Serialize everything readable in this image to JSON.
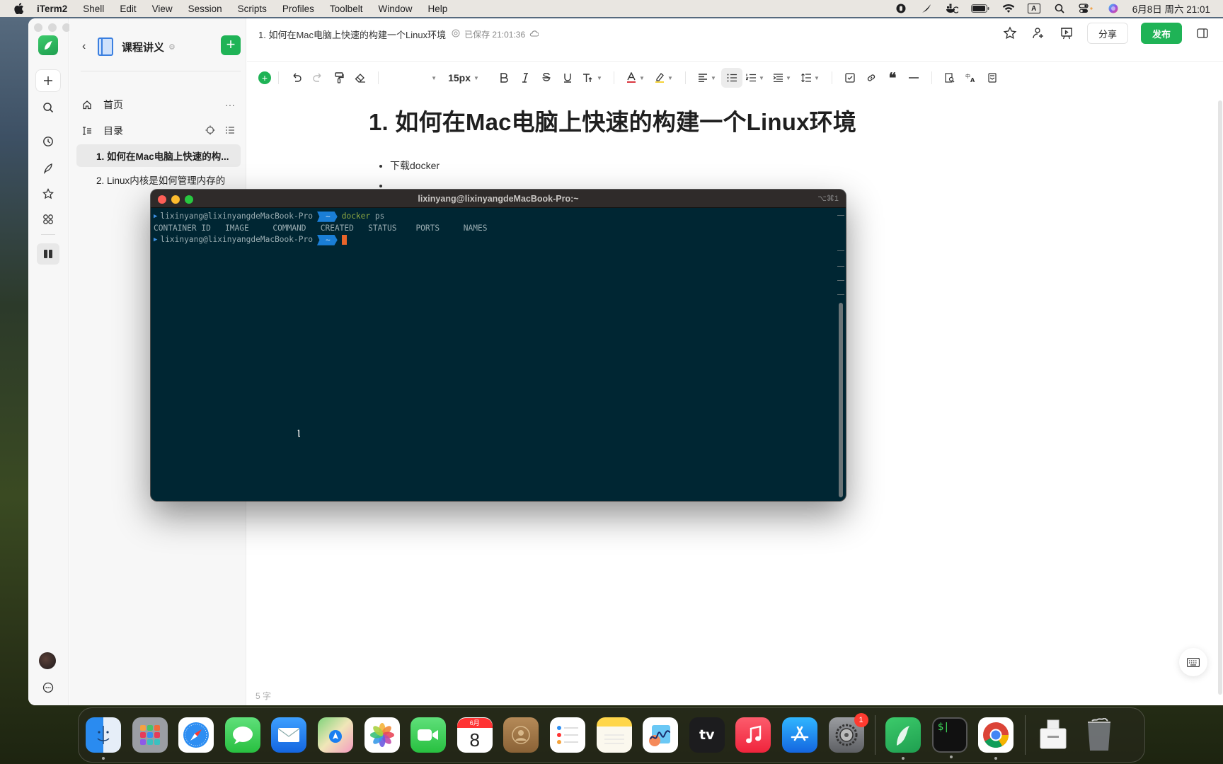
{
  "menubar": {
    "app": "iTerm2",
    "items": [
      "Shell",
      "Edit",
      "View",
      "Session",
      "Scripts",
      "Profiles",
      "Toolbelt",
      "Window",
      "Help"
    ],
    "status_icons": [
      "record-icon",
      "feather-icon",
      "docker-icon",
      "battery-icon",
      "wifi-icon",
      "input-source-icon",
      "spotlight-icon",
      "control-center-icon",
      "siri-icon"
    ],
    "input_source": "A",
    "clock": "6月8日 周六  21:01"
  },
  "sidebar": {
    "book_title": "课程讲义",
    "nav": [
      {
        "label": "首页",
        "icon": "home-icon"
      },
      {
        "label": "目录",
        "icon": "toc-icon"
      }
    ],
    "toc": [
      {
        "label": "1. 如何在Mac电脑上快速的构...",
        "active": true
      },
      {
        "label": "2. Linux内核是如何管理内存的",
        "active": false
      }
    ]
  },
  "editor": {
    "doc_title": "1. 如何在Mac电脑上快速的构建一个Linux环境",
    "saved_status": "已保存 21:01:36",
    "share_label": "分享",
    "publish_label": "发布",
    "font_size": "15px",
    "heading": "1. 如何在Mac电脑上快速的构建一个Linux环境",
    "bullets": [
      "下载docker",
      ""
    ],
    "word_count": "5 字"
  },
  "terminal": {
    "title": "lixinyang@lixinyangdeMacBook-Pro:~",
    "shortcut": "⌥⌘1",
    "prompt_user": "lixinyang@lixinyangdeMacBook-Pro",
    "prompt_dir": "~",
    "command": "docker",
    "command_arg": "ps",
    "output_header": "CONTAINER ID   IMAGE     COMMAND   CREATED   STATUS    PORTS     NAMES"
  },
  "dock": {
    "apps": [
      {
        "name": "Finder",
        "running": true
      },
      {
        "name": "Launchpad"
      },
      {
        "name": "Safari"
      },
      {
        "name": "Messages"
      },
      {
        "name": "Mail"
      },
      {
        "name": "Maps"
      },
      {
        "name": "Photos"
      },
      {
        "name": "FaceTime"
      },
      {
        "name": "Calendar",
        "month": "6月",
        "day": "8"
      },
      {
        "name": "Contacts"
      },
      {
        "name": "Reminders"
      },
      {
        "name": "Notes"
      },
      {
        "name": "Freeform"
      },
      {
        "name": "TV",
        "label": "tv"
      },
      {
        "name": "Music"
      },
      {
        "name": "App Store"
      },
      {
        "name": "System Settings",
        "badge": "1"
      }
    ],
    "recent": [
      {
        "name": "Yuque",
        "running": true
      },
      {
        "name": "iTerm2",
        "running": true
      },
      {
        "name": "Chrome",
        "running": true
      }
    ],
    "trash": [
      "Downloads",
      "Trash"
    ]
  }
}
